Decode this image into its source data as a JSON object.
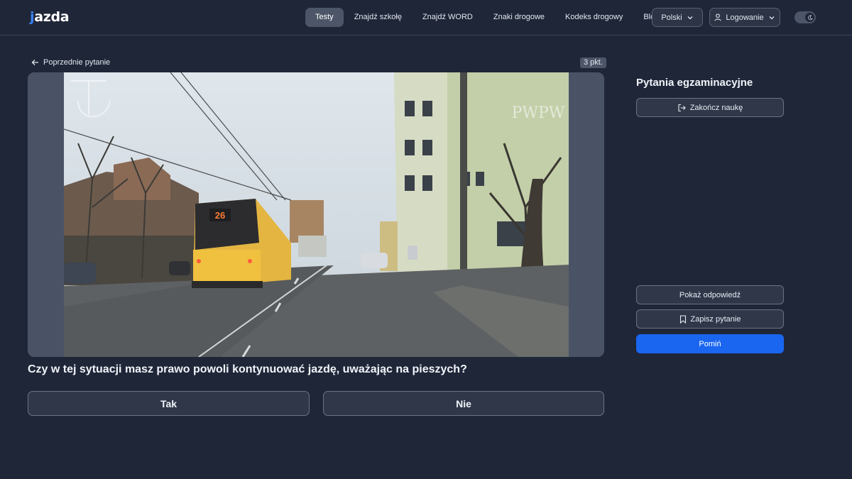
{
  "header": {
    "logo_text": "jazda",
    "nav": [
      {
        "label": "Testy",
        "active": true
      },
      {
        "label": "Znajdź szkołę"
      },
      {
        "label": "Znajdź WORD"
      },
      {
        "label": "Znaki drogowe"
      },
      {
        "label": "Kodeks drogowy"
      },
      {
        "label": "Blog"
      }
    ],
    "language": "Polski",
    "login": "Logowanie",
    "theme": "dark"
  },
  "main": {
    "prev_question": "Poprzednie pytanie",
    "points": "3 pkt.",
    "question": "Czy w tej sytuacji masz prawo powoli kontynuować jazdę, uważając na pieszych?",
    "answers": [
      "Tak",
      "Nie"
    ],
    "media": {
      "tram_number": "26",
      "watermark": "PWPW"
    }
  },
  "sidebar": {
    "title": "Pytania egzaminacyjne",
    "end_button": "Zakończ naukę",
    "show_answer": "Pokaż odpowiedź",
    "save_question": "Zapisz pytanie",
    "skip": "Pomiń"
  },
  "colors": {
    "background": "#1f2638",
    "accent": "#1a66f0",
    "logo_accent": "#3b82f6"
  }
}
